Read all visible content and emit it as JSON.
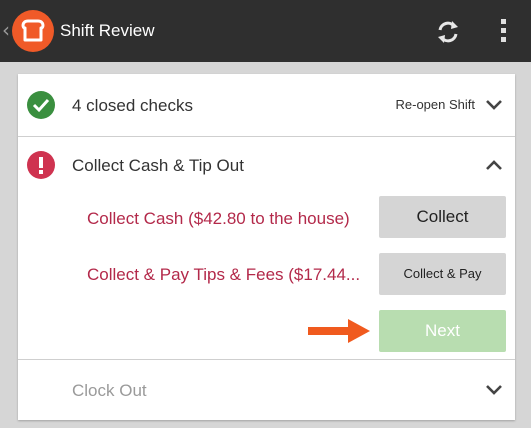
{
  "appbar": {
    "title": "Shift Review",
    "back_icon": "chevron-left-icon",
    "logo_icon": "toast-logo-icon",
    "refresh_icon": "refresh-icon",
    "menu_icon": "more-vert-icon"
  },
  "sections": {
    "closed_checks": {
      "label": "4 closed checks",
      "action": "Re-open Shift",
      "status_color": "#3a8f3f"
    },
    "collect": {
      "label": "Collect Cash & Tip Out",
      "status_color": "#cf3350",
      "items": [
        {
          "label": "Collect Cash ($42.80 to the house)",
          "button": "Collect"
        },
        {
          "label": "Collect & Pay Tips & Fees ($17.44...",
          "button": "Collect & Pay"
        }
      ],
      "next_button": "Next"
    },
    "clock_out": {
      "label": "Clock Out"
    }
  },
  "colors": {
    "accent_orange": "#f05a28",
    "link_red": "#b3294a",
    "next_green": "#b8ddb0"
  }
}
